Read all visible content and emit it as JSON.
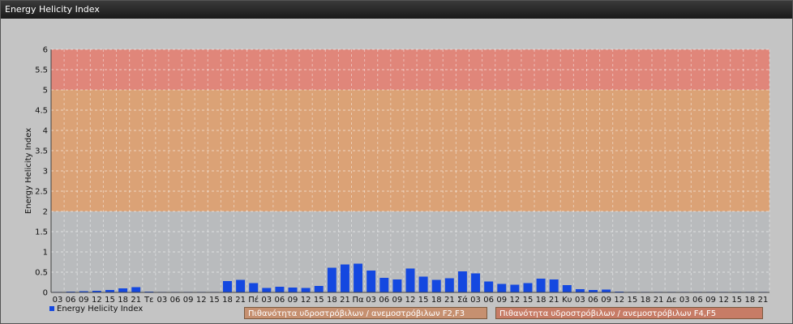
{
  "window": {
    "title": "Energy Helicity Index"
  },
  "colors": {
    "bar": "#1448e0",
    "zone_high": "#e0867a",
    "zone_mid": "#dba276",
    "zone_low": "#b9bbbd",
    "plot_bg": "#c4c4c4"
  },
  "legend": {
    "series_label": "Energy Helicity Index",
    "zone_f2f3": "Πιθανότητα υδροστρόβιλων / ανεμοστρόβιλων F2,F3",
    "zone_f4f5": "Πιθανότητα υδροστρόβιλων / ανεμοστρόβιλων F4,F5",
    "zone_f2f3_color": "#c69070",
    "zone_f4f5_color": "#c77c66"
  },
  "chart_data": {
    "type": "bar",
    "ylabel": "Energy Helicity Index",
    "xlabel": "",
    "ylim": [
      0,
      6
    ],
    "yticks": [
      "0",
      "0.5",
      "1",
      "1.5",
      "2",
      "2.5",
      "3",
      "3.5",
      "4",
      "4.5",
      "5",
      "5.5",
      "6"
    ],
    "zones": [
      {
        "from": 0,
        "to": 2,
        "color": "#b9bbbd"
      },
      {
        "from": 2,
        "to": 5,
        "color": "#dba276"
      },
      {
        "from": 5,
        "to": 6,
        "color": "#e0867a"
      }
    ],
    "grid": true,
    "categories": [
      "03",
      "06",
      "09",
      "12",
      "15",
      "18",
      "21",
      "Τε",
      "03",
      "06",
      "09",
      "12",
      "15",
      "18",
      "21",
      "Πέ",
      "03",
      "06",
      "09",
      "12",
      "15",
      "18",
      "21",
      "Πα",
      "03",
      "06",
      "09",
      "12",
      "15",
      "18",
      "21",
      "Σά",
      "03",
      "06",
      "09",
      "12",
      "15",
      "18",
      "21",
      "Κυ",
      "03",
      "06",
      "09",
      "12",
      "15",
      "18",
      "21",
      "Δε",
      "03",
      "06",
      "09",
      "12",
      "15",
      "18",
      "21"
    ],
    "values": [
      0.01,
      0.02,
      0.03,
      0.04,
      0.06,
      0.1,
      0.13,
      0.02,
      0.01,
      0.0,
      0.0,
      0.01,
      0.01,
      0.28,
      0.31,
      0.23,
      0.11,
      0.14,
      0.12,
      0.11,
      0.16,
      0.61,
      0.69,
      0.71,
      0.54,
      0.36,
      0.32,
      0.59,
      0.39,
      0.31,
      0.35,
      0.52,
      0.47,
      0.27,
      0.21,
      0.19,
      0.23,
      0.34,
      0.32,
      0.18,
      0.08,
      0.06,
      0.07,
      0.02,
      0.01,
      0.01,
      0.01,
      0.01,
      0.01,
      0.01,
      0.01,
      0.01,
      0.01,
      0.01,
      0.01
    ]
  }
}
